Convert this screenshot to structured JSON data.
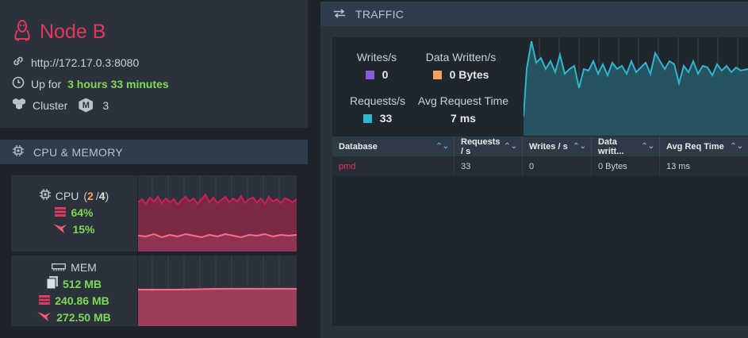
{
  "node": {
    "name": "Node B",
    "url": "http://172.17.0.3:8080",
    "uptime_prefix": "Up for",
    "uptime": "3 hours 33 minutes",
    "cluster_label": "Cluster",
    "cluster_badge": "M",
    "cluster_count": "3"
  },
  "cpu_section": {
    "title": "CPU & MEMORY",
    "cpu_label": "CPU",
    "cpu_open": "(",
    "cpu_used": "2",
    "cpu_sep": "/",
    "cpu_total": "4",
    "cpu_close": ")",
    "cpu_usage": "64%",
    "cpu_other": "15%",
    "mem_label": "MEM",
    "mem_total": "512 MB",
    "mem_used": "240.86 MB",
    "mem_other": "272.50 MB"
  },
  "traffic": {
    "title": "TRAFFIC",
    "writes_label": "Writes/s",
    "writes_value": "0",
    "data_written_label": "Data Written/s",
    "data_written_value": "0 Bytes",
    "requests_label": "Requests/s",
    "requests_value": "33",
    "avg_req_label": "Avg Request Time",
    "avg_req_value": "7 ms"
  },
  "table": {
    "headers": [
      "Database",
      "Requests / s",
      "Writes / s",
      "Data writt...",
      "Avg Req Time"
    ],
    "rows": [
      [
        "pmd",
        "33",
        "0",
        "0 Bytes",
        "13 ms"
      ]
    ]
  },
  "colors": {
    "accent_red": "#e0395d",
    "green": "#7ed957",
    "orange": "#f5a35c",
    "writes_swatch": "#8a5bd6",
    "data_written_swatch": "#f5a35c",
    "requests_swatch": "#2fb6cc",
    "traffic_line": "#2fb6cc"
  }
}
